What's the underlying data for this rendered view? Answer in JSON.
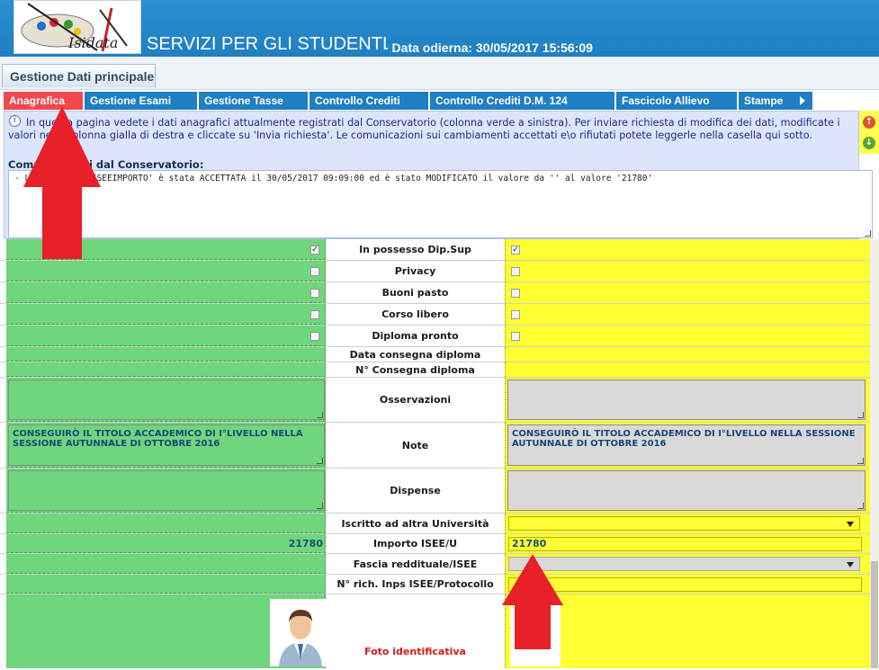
{
  "header": {
    "logo_text": "Isidata",
    "app_title": "SERVIZI PER GLI STUDENTI",
    "date_label": "- Data odierna: 30/05/2017 15:56:09"
  },
  "main_tab": "Gestione Dati principale",
  "menu": [
    {
      "label": "Anagrafica",
      "active": true
    },
    {
      "label": "Gestione Esami",
      "active": false
    },
    {
      "label": "Gestione Tasse",
      "active": false
    },
    {
      "label": "Controllo Crediti",
      "active": false
    },
    {
      "label": "Controllo Crediti D.M. 124",
      "active": false
    },
    {
      "label": "Fascicolo Allievo",
      "active": false
    },
    {
      "label": "Stampe",
      "active": false
    }
  ],
  "info": {
    "text": "In questa pagina vedete i dati anagrafici attualmente registrati dal Conservatorio (colonna verde a sinistra). Per inviare richiesta di modifica dei dati, modificate i valori nella colonna gialla di destra e cliccate su 'Invia richiesta'. Le comunicazioni sui cambiamenti accettati e\\o rifiutati potete leggerle nella casella qui sotto.",
    "comm_label": "Comunicazioni dal Conservatorio:",
    "comm_text": "- La modifica 'ISEEIMPORTO' è stata ACCETTATA il 30/05/2017 09:09:00 ed è stato MODIFICATO il valore da '' al valore '21780'"
  },
  "fields": {
    "dip_sup": "In possesso Dip.Sup",
    "privacy": "Privacy",
    "buoni_pasto": "Buoni pasto",
    "corso_libero": "Corso libero",
    "diploma_pronto": "Diploma pronto",
    "data_consegna": "Data consegna diploma",
    "n_consegna": "N° Consegna diploma",
    "osservazioni": "Osservazioni",
    "note": "Note",
    "note_value": "CONSEGUIRÒ IL TITOLO ACCADEMICO DI I°LIVELLO NELLA SESSIONE AUTUNNALE DI OTTOBRE 2016",
    "dispense": "Dispense",
    "iscritto": "Iscritto ad altra Università",
    "importo": "Importo ISEE/U",
    "importo_value": "21780",
    "fascia": "Fascia reddituale/ISEE",
    "inps": "N° rich. Inps ISEE/Protocollo",
    "foto": "Foto identificativa"
  },
  "checkbox_state": {
    "dip_sup": true,
    "privacy": false,
    "buoni_pasto": false,
    "corso_libero": false,
    "diploma_pronto": false
  },
  "colors": {
    "header_blue": "#1f7fc2",
    "active_tab_red": "#f0484e",
    "left_green": "#6fd67c",
    "right_yellow": "#ffff33",
    "annotation_red": "#e8202a"
  }
}
